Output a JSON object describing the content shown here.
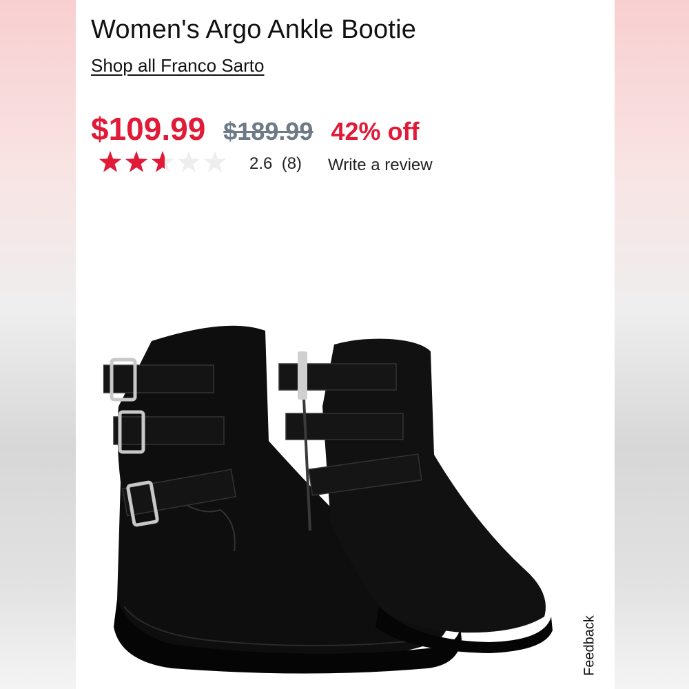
{
  "product": {
    "title": "Women's Argo Ankle Bootie",
    "shop_link": "Shop all Franco Sarto",
    "price": {
      "sale": "$109.99",
      "original": "$189.99",
      "discount": "42% off"
    },
    "rating": {
      "value": 2.6,
      "max": 5,
      "display_value": "2.6",
      "count": "(8)",
      "write_review": "Write a review"
    },
    "image_icon": "black-buckle-ankle-boots"
  },
  "feedback": {
    "label": "Feedback"
  },
  "colors": {
    "accent": "#e11a38",
    "muted": "#6e7a85",
    "text": "#111111"
  }
}
